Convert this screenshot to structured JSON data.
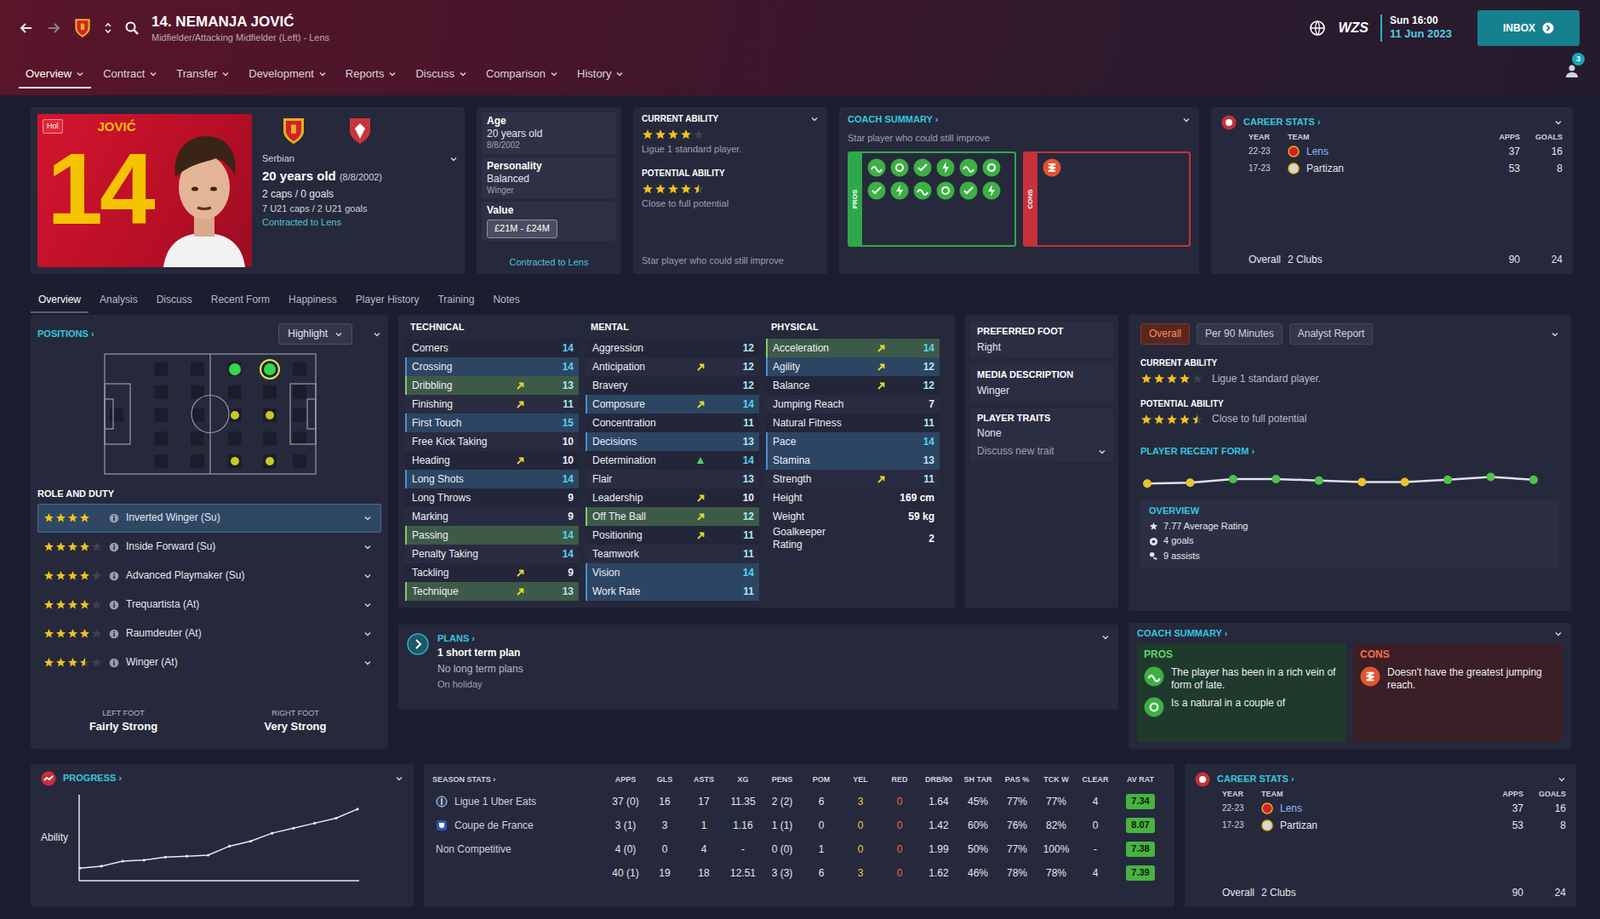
{
  "header": {
    "title": "14. NEMANJA JOVIĆ",
    "subtitle": "Midfielder/Attacking Midfielder (Left) - Lens",
    "brand": "WZS",
    "time": "Sun 16:00",
    "date": "11 Jun 2023",
    "inbox": "INBOX",
    "notifications": "3"
  },
  "menu": [
    {
      "label": "Overview",
      "selected": true
    },
    {
      "label": "Contract",
      "selected": false
    },
    {
      "label": "Transfer",
      "selected": false
    },
    {
      "label": "Development",
      "selected": false
    },
    {
      "label": "Reports",
      "selected": false
    },
    {
      "label": "Discuss",
      "selected": false
    },
    {
      "label": "Comparison",
      "selected": false
    },
    {
      "label": "History",
      "selected": false
    }
  ],
  "profile": {
    "badge": "Hol",
    "shirt_name": "JOVIĆ",
    "shirt_number": "14",
    "nationality": "Serbian",
    "age": "20 years old",
    "dob": "(8/8/2002)",
    "caps": "2 caps / 0 goals",
    "u21": "7 U21 caps / 2 U21 goals",
    "contract": "Contracted to Lens"
  },
  "info": {
    "age_label": "Age",
    "age": "20 years old",
    "dob": "8/8/2002",
    "personality_label": "Personality",
    "personality": "Balanced",
    "media": "Winger",
    "value_label": "Value",
    "value": "£21M - £24M",
    "contract": "Contracted to Lens"
  },
  "ability": {
    "ca_label": "CURRENT ABILITY",
    "ca_stars": 4,
    "ca_text": "Ligue 1 standard player.",
    "pa_label": "POTENTIAL ABILITY",
    "pa_stars": 4.5,
    "pa_text": "Close to full potential",
    "summary": "Star player who could still improve"
  },
  "coach_card": {
    "title": "COACH SUMMARY ›",
    "summary": "Star player who could still improve",
    "pros_label": "PROS",
    "cons_label": "CONS",
    "pros_icons": 12,
    "cons_icons": 1
  },
  "career_top": {
    "title": "CAREER STATS ›",
    "columns": [
      "YEAR",
      "TEAM",
      "APPS",
      "GOALS"
    ],
    "rows": [
      {
        "year": "22-23",
        "team": "Lens",
        "apps": "37",
        "goals": "16",
        "color": "#d4202c",
        "current": true
      },
      {
        "year": "17-23",
        "team": "Partizan",
        "apps": "53",
        "goals": "8",
        "color": "#d8d8d8",
        "current": false
      }
    ],
    "total": {
      "label": "Overall",
      "clubs": "2 Clubs",
      "apps": "90",
      "goals": "24"
    }
  },
  "subtabs": [
    {
      "label": "Overview",
      "selected": true
    },
    {
      "label": "Analysis",
      "selected": false
    },
    {
      "label": "Discuss",
      "selected": false
    },
    {
      "label": "Recent Form",
      "selected": false
    },
    {
      "label": "Happiness",
      "selected": false
    },
    {
      "label": "Player History",
      "selected": false
    },
    {
      "label": "Training",
      "selected": false
    },
    {
      "label": "Notes",
      "selected": false
    }
  ],
  "positions": {
    "title": "POSITIONS ›",
    "highlight": "Highlight",
    "spots": [
      {
        "slot": "M-L",
        "rating": "natural",
        "selected": false
      },
      {
        "slot": "AM-L",
        "rating": "natural",
        "selected": true
      },
      {
        "slot": "M-C",
        "rating": "awkward",
        "selected": false
      },
      {
        "slot": "AM-C",
        "rating": "awkward",
        "selected": false
      },
      {
        "slot": "M-R",
        "rating": "awkward",
        "selected": false
      },
      {
        "slot": "AM-R",
        "rating": "awkward",
        "selected": false
      }
    ]
  },
  "roles": {
    "title": "ROLE AND DUTY",
    "items": [
      {
        "name": "Inverted Winger (Su)",
        "stars": 4,
        "selected": true
      },
      {
        "name": "Inside Forward (Su)",
        "stars": 4,
        "selected": false
      },
      {
        "name": "Advanced Playmaker (Su)",
        "stars": 4,
        "selected": false
      },
      {
        "name": "Trequartista (At)",
        "stars": 4,
        "selected": false
      },
      {
        "name": "Raumdeuter (At)",
        "stars": 4,
        "selected": false
      },
      {
        "name": "Winger (At)",
        "stars": 3.5,
        "selected": false
      }
    ]
  },
  "feet": [
    {
      "label": "LEFT FOOT",
      "value": "Fairly Strong"
    },
    {
      "label": "RIGHT FOOT",
      "value": "Very Strong"
    }
  ],
  "attributes": {
    "groups": [
      {
        "title": "TECHNICAL",
        "items": [
          {
            "name": "Corners",
            "value": "14",
            "kind": "none",
            "trend": "none"
          },
          {
            "name": "Crossing",
            "value": "14",
            "kind": "pref",
            "trend": "none"
          },
          {
            "name": "Dribbling",
            "value": "13",
            "kind": "key",
            "trend": "rising"
          },
          {
            "name": "Finishing",
            "value": "11",
            "kind": "none",
            "trend": "rising"
          },
          {
            "name": "First Touch",
            "value": "15",
            "kind": "pref",
            "trend": "none"
          },
          {
            "name": "Free Kick Taking",
            "value": "10",
            "kind": "none",
            "trend": "none"
          },
          {
            "name": "Heading",
            "value": "10",
            "kind": "none",
            "trend": "rising"
          },
          {
            "name": "Long Shots",
            "value": "14",
            "kind": "pref",
            "trend": "none"
          },
          {
            "name": "Long Throws",
            "value": "9",
            "kind": "none",
            "trend": "none"
          },
          {
            "name": "Marking",
            "value": "9",
            "kind": "none",
            "trend": "none"
          },
          {
            "name": "Passing",
            "value": "14",
            "kind": "key",
            "trend": "none"
          },
          {
            "name": "Penalty Taking",
            "value": "14",
            "kind": "none",
            "trend": "none"
          },
          {
            "name": "Tackling",
            "value": "9",
            "kind": "none",
            "trend": "rising"
          },
          {
            "name": "Technique",
            "value": "13",
            "kind": "key",
            "trend": "rising"
          }
        ]
      },
      {
        "title": "MENTAL",
        "items": [
          {
            "name": "Aggression",
            "value": "12",
            "kind": "none",
            "trend": "none"
          },
          {
            "name": "Anticipation",
            "value": "12",
            "kind": "none",
            "trend": "rising"
          },
          {
            "name": "Bravery",
            "value": "12",
            "kind": "none",
            "trend": "none"
          },
          {
            "name": "Composure",
            "value": "14",
            "kind": "pref",
            "trend": "rising"
          },
          {
            "name": "Concentration",
            "value": "11",
            "kind": "none",
            "trend": "none"
          },
          {
            "name": "Decisions",
            "value": "13",
            "kind": "pref",
            "trend": "none"
          },
          {
            "name": "Determination",
            "value": "14",
            "kind": "none",
            "trend": "surging"
          },
          {
            "name": "Flair",
            "value": "13",
            "kind": "none",
            "trend": "none"
          },
          {
            "name": "Leadership",
            "value": "10",
            "kind": "none",
            "trend": "rising"
          },
          {
            "name": "Off The Ball",
            "value": "12",
            "kind": "key",
            "trend": "rising"
          },
          {
            "name": "Positioning",
            "value": "11",
            "kind": "none",
            "trend": "rising"
          },
          {
            "name": "Teamwork",
            "value": "11",
            "kind": "none",
            "trend": "none"
          },
          {
            "name": "Vision",
            "value": "14",
            "kind": "pref",
            "trend": "none"
          },
          {
            "name": "Work Rate",
            "value": "11",
            "kind": "pref",
            "trend": "none"
          }
        ]
      },
      {
        "title": "PHYSICAL",
        "items": [
          {
            "name": "Acceleration",
            "value": "14",
            "kind": "key",
            "trend": "rising"
          },
          {
            "name": "Agility",
            "value": "12",
            "kind": "pref",
            "trend": "rising"
          },
          {
            "name": "Balance",
            "value": "12",
            "kind": "none",
            "trend": "rising"
          },
          {
            "name": "Jumping Reach",
            "value": "7",
            "kind": "none",
            "trend": "none"
          },
          {
            "name": "Natural Fitness",
            "value": "11",
            "kind": "none",
            "trend": "none"
          },
          {
            "name": "Pace",
            "value": "14",
            "kind": "pref",
            "trend": "none"
          },
          {
            "name": "Stamina",
            "value": "13",
            "kind": "pref",
            "trend": "none"
          },
          {
            "name": "Strength",
            "value": "11",
            "kind": "none",
            "trend": "rising"
          },
          {
            "name": "Height",
            "value": "169 cm",
            "kind": "extra",
            "trend": "none"
          },
          {
            "name": "Weight",
            "value": "59 kg",
            "kind": "extra",
            "trend": "none"
          },
          {
            "name": "Goalkeeper Rating",
            "value": "2",
            "kind": "extra",
            "trend": "none"
          }
        ]
      }
    ]
  },
  "details": {
    "items": [
      {
        "label": "PREFERRED FOOT",
        "value": "Right"
      },
      {
        "label": "MEDIA DESCRIPTION",
        "value": "Winger"
      },
      {
        "label": "PLAYER TRAITS",
        "value": "None"
      }
    ],
    "discuss": "Discuss new trait"
  },
  "plans": {
    "title": "PLANS ›",
    "short": "1 short term plan",
    "long": "No long term plans",
    "status": "On holiday"
  },
  "overview_panel": {
    "tabs": [
      {
        "label": "Overall",
        "selected": true
      },
      {
        "label": "Per 90 Minutes",
        "selected": false
      },
      {
        "label": "Analyst Report",
        "selected": false
      }
    ],
    "ca_label": "CURRENT ABILITY",
    "ca_stars": 4,
    "ca_text": "Ligue 1 standard player.",
    "pa_label": "POTENTIAL ABILITY",
    "pa_stars": 4.5,
    "pa_text": "Close to full potential",
    "form_title": "PLAYER RECENT FORM ›",
    "form": [
      6.9,
      7.0,
      7.5,
      7.5,
      7.3,
      7.1,
      7.1,
      7.4,
      7.8,
      7.4
    ],
    "overview_title": "OVERVIEW",
    "stats": [
      "7.77 Average Rating",
      "4 goals",
      "9 assists"
    ]
  },
  "coach_bottom": {
    "title": "COACH SUMMARY ›",
    "pros_label": "PROS",
    "cons_label": "CONS",
    "pros": [
      "The player has been in a rich vein of form of late.",
      "Is a natural in a couple of"
    ],
    "cons": [
      "Doesn't have the greatest jumping reach."
    ]
  },
  "progress": {
    "title": "PROGRESS ›",
    "axis": "Ability",
    "values": [
      10,
      12,
      17,
      18,
      21,
      22,
      23,
      32,
      37,
      45,
      50,
      55,
      60,
      69
    ]
  },
  "season": {
    "title": "SEASON STATS ›",
    "columns": [
      "APPS",
      "GLS",
      "ASTS",
      "XG",
      "PENS",
      "POM",
      "YEL",
      "RED",
      "DRB/90",
      "SH TAR",
      "PAS %",
      "TCK W",
      "CLEAR",
      "AV RAT"
    ],
    "rows": [
      {
        "competition": "Ligue 1 Uber Eats",
        "kind": "league",
        "cells": [
          "37 (0)",
          "16",
          "17",
          "11.35",
          "2 (2)",
          "6",
          "3",
          "0",
          "1.64",
          "45%",
          "77%",
          "77%",
          "4",
          "7.34"
        ]
      },
      {
        "competition": "Coupe de France",
        "kind": "cup",
        "cells": [
          "3 (1)",
          "3",
          "1",
          "1.16",
          "1 (1)",
          "0",
          "0",
          "0",
          "1.42",
          "60%",
          "76%",
          "82%",
          "0",
          "8.07"
        ]
      },
      {
        "competition": "Non Competitive",
        "kind": "friendly",
        "cells": [
          "4 (0)",
          "0",
          "4",
          "-",
          "0 (0)",
          "1",
          "0",
          "0",
          "1.99",
          "50%",
          "77%",
          "100%",
          "-",
          "7.38"
        ]
      }
    ],
    "total": [
      "40 (1)",
      "19",
      "18",
      "12.51",
      "3 (3)",
      "6",
      "3",
      "0",
      "1.62",
      "46%",
      "78%",
      "78%",
      "4",
      "7.39"
    ]
  },
  "career_bottom": {
    "title": "CAREER STATS ›",
    "columns": [
      "YEAR",
      "TEAM",
      "APPS",
      "GOALS"
    ],
    "rows": [
      {
        "year": "22-23",
        "team": "Lens",
        "apps": "37",
        "goals": "16",
        "color": "#d4202c",
        "current": true
      },
      {
        "year": "17-23",
        "team": "Partizan",
        "apps": "53",
        "goals": "8",
        "color": "#d8d8d8",
        "current": false
      }
    ],
    "total": {
      "label": "Overall",
      "clubs": "2 Clubs",
      "apps": "90",
      "goals": "24"
    }
  }
}
